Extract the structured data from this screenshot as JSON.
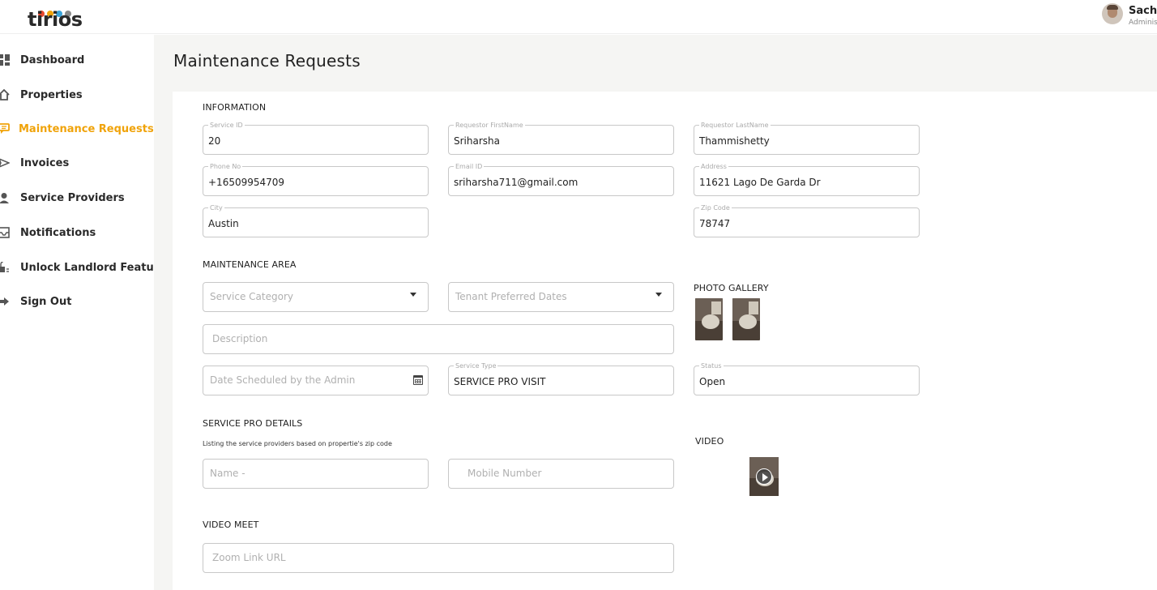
{
  "header": {
    "logo_text": "tirios",
    "logo_dot_colors": [
      "#e8492f",
      "#f0a30a",
      "#3aa3d9",
      "#8a8a8a"
    ],
    "user_name": "Sachi",
    "user_role": "Adminis"
  },
  "sidebar": {
    "accent": "#f0a30a",
    "items": [
      {
        "label": "Dashboard",
        "icon": "dashboard-icon"
      },
      {
        "label": "Properties",
        "icon": "home-icon"
      },
      {
        "label": "Maintenance Requests",
        "icon": "chat-icon",
        "active": true
      },
      {
        "label": "Invoices",
        "icon": "send-icon"
      },
      {
        "label": "Service Providers",
        "icon": "person-icon"
      },
      {
        "label": "Notifications",
        "icon": "inbox-icon"
      },
      {
        "label": "Unlock Landlord Feature",
        "icon": "unlock-icon"
      },
      {
        "label": "Sign Out",
        "icon": "sign-out-icon"
      }
    ]
  },
  "page": {
    "title": "Maintenance Requests"
  },
  "information": {
    "section_label": "INFORMATION",
    "service_id": {
      "label": "Service ID",
      "value": "20"
    },
    "first_name": {
      "label": "Requestor FirstName",
      "value": "Sriharsha"
    },
    "last_name": {
      "label": "Requestor LastName",
      "value": "Thammishetty"
    },
    "phone": {
      "label": "Phone No",
      "value": "+16509954709"
    },
    "email": {
      "label": "Email ID",
      "value": "sriharsha711@gmail.com"
    },
    "address": {
      "label": "Address",
      "value": "11621 Lago De Garda Dr"
    },
    "city": {
      "label": "City",
      "value": "Austin"
    },
    "zip": {
      "label": "Zip Code",
      "value": "78747"
    }
  },
  "maintenance_area": {
    "section_label": "MAINTENANCE AREA",
    "service_category": {
      "placeholder": "Service Category"
    },
    "preferred_dates": {
      "placeholder": "Tenant Preferred Dates"
    },
    "description": {
      "placeholder": "Description"
    },
    "date_scheduled": {
      "placeholder": "Date Scheduled by the Admin"
    },
    "service_type": {
      "label": "Service Type",
      "value": "SERVICE PRO VISIT"
    },
    "status": {
      "label": "Status",
      "value": "Open"
    },
    "photo_gallery_label": "PHOTO GALLERY"
  },
  "service_pro": {
    "section_label": "SERVICE PRO DETAILS",
    "hint": "Listing the service providers based on propertie's zip code",
    "name": {
      "placeholder": "Name -"
    },
    "mobile": {
      "placeholder": "Mobile Number"
    },
    "video_label": "VIDEO"
  },
  "video_meet": {
    "section_label": "VIDEO MEET",
    "zoom": {
      "placeholder": "Zoom Link URL"
    }
  }
}
